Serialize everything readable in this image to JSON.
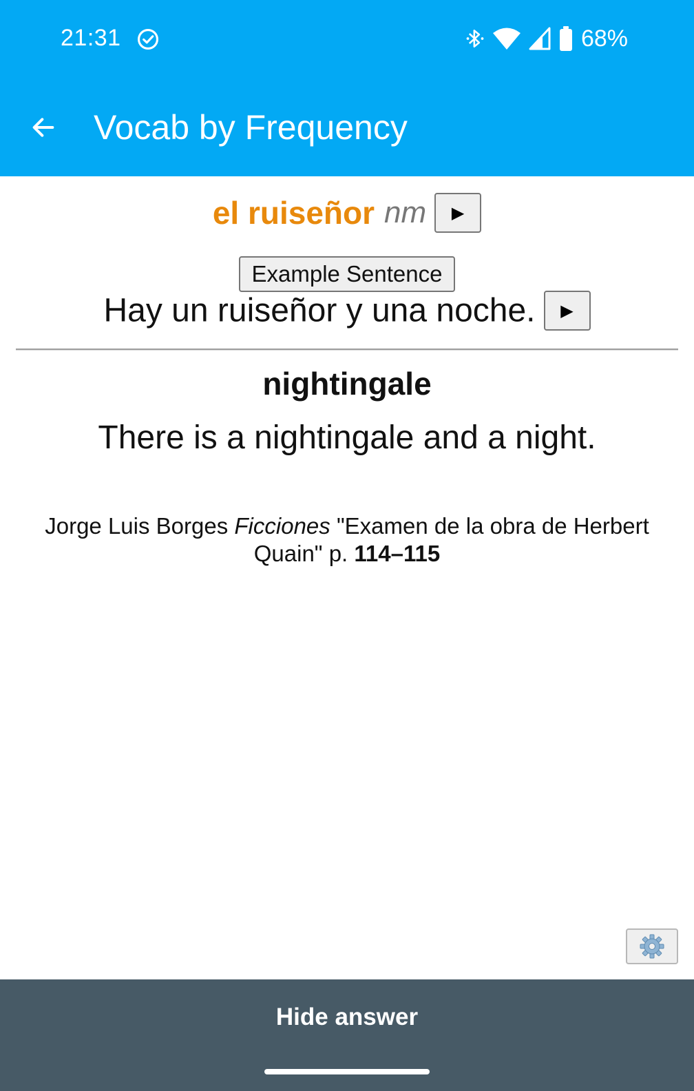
{
  "status_bar": {
    "time": "21:31",
    "battery_percent": "68%",
    "icons": [
      "check-circle-icon",
      "bluetooth-icon",
      "wifi-icon",
      "cell-signal-icon",
      "battery-icon"
    ]
  },
  "toolbar": {
    "back_icon": "arrow-left-icon",
    "title": "Vocab by Frequency"
  },
  "card": {
    "word": "el ruiseñor",
    "part_of_speech": "nm",
    "play_label": "▶",
    "example_button_label": "Example Sentence",
    "example_sentence": "Hay un ruiseñor y una noche.",
    "translation": "nightingale",
    "translation_sentence": "There is a nightingale and a night.",
    "source": {
      "author": "Jorge Luis Borges",
      "book": "Ficciones",
      "chapter": "\"Examen de la obra de Herbert Quain\" p.",
      "pages": "114–115"
    },
    "settings_icon": "gear-icon"
  },
  "bottom_bar": {
    "hide_answer_label": "Hide answer"
  },
  "colors": {
    "app_bar": "#03a9f4",
    "word": "#e8890c",
    "bottom_bar": "#475a66"
  }
}
